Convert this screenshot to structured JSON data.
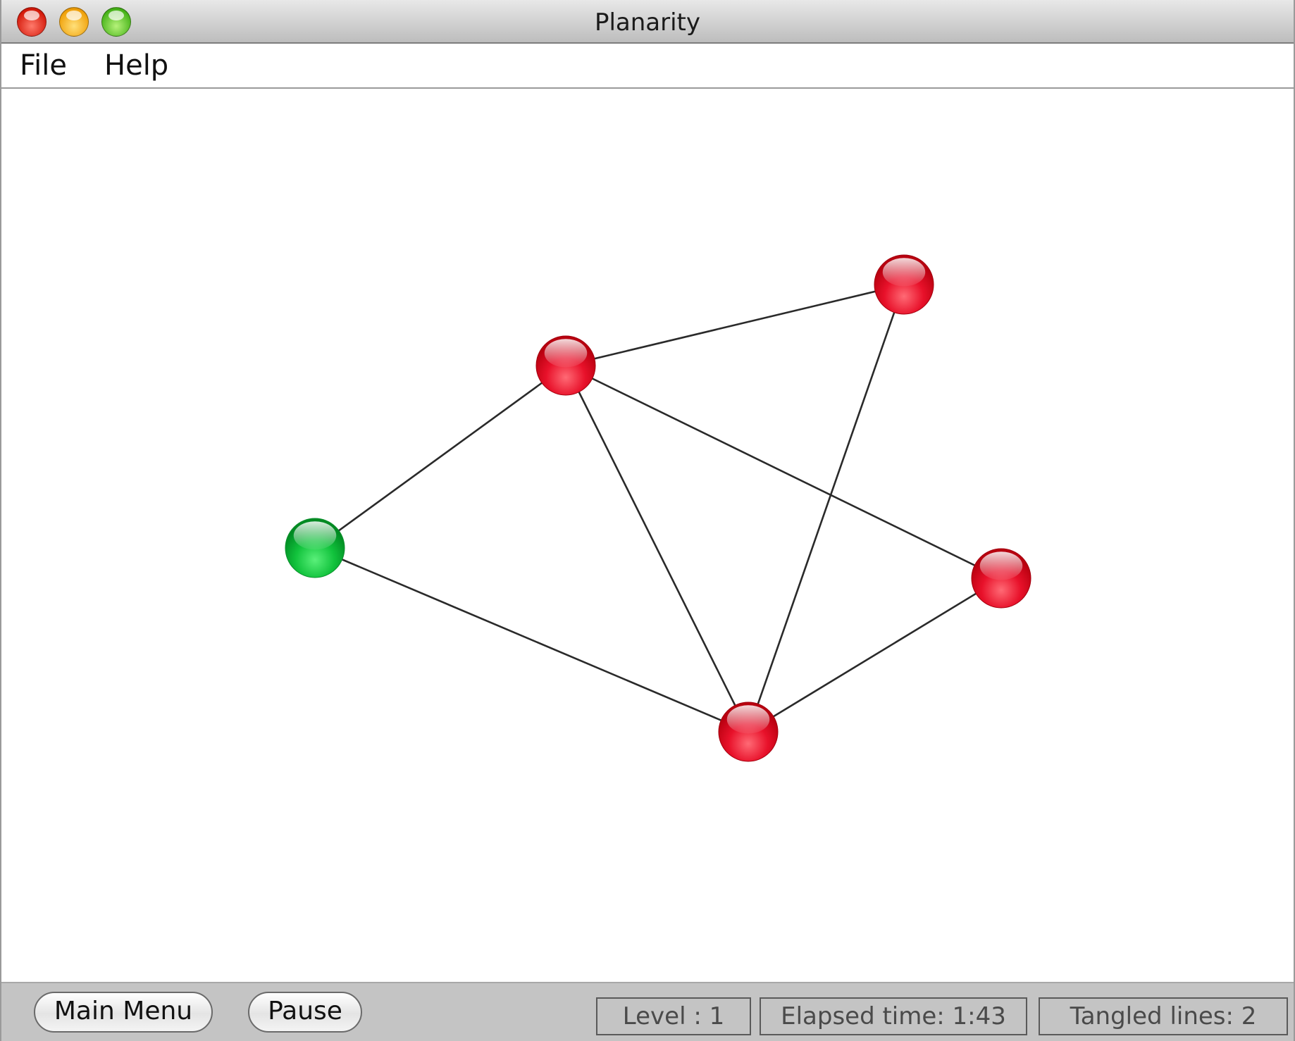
{
  "window": {
    "title": "Planarity"
  },
  "menu": {
    "items": [
      {
        "label": "File"
      },
      {
        "label": "Help"
      }
    ]
  },
  "graph": {
    "colors": {
      "edge": "#2a2a2a",
      "vertex_active": "#e0001c",
      "vertex_selected": "#00b233"
    },
    "vertices": [
      {
        "id": "v-top-right",
        "state": "red"
      },
      {
        "id": "v-upper-middle",
        "state": "red"
      },
      {
        "id": "v-left",
        "state": "green"
      },
      {
        "id": "v-right",
        "state": "red"
      },
      {
        "id": "v-bottom",
        "state": "red"
      }
    ],
    "edges": [
      [
        "v-upper-middle",
        "v-top-right"
      ],
      [
        "v-upper-middle",
        "v-left"
      ],
      [
        "v-upper-middle",
        "v-bottom"
      ],
      [
        "v-upper-middle",
        "v-right"
      ],
      [
        "v-top-right",
        "v-bottom"
      ],
      [
        "v-left",
        "v-bottom"
      ],
      [
        "v-right",
        "v-bottom"
      ]
    ]
  },
  "controls": {
    "main_menu_label": "Main Menu",
    "pause_label": "Pause"
  },
  "status": {
    "level": "Level : 1",
    "elapsed": "Elapsed time: 1:43",
    "tangled": "Tangled lines: 2"
  }
}
